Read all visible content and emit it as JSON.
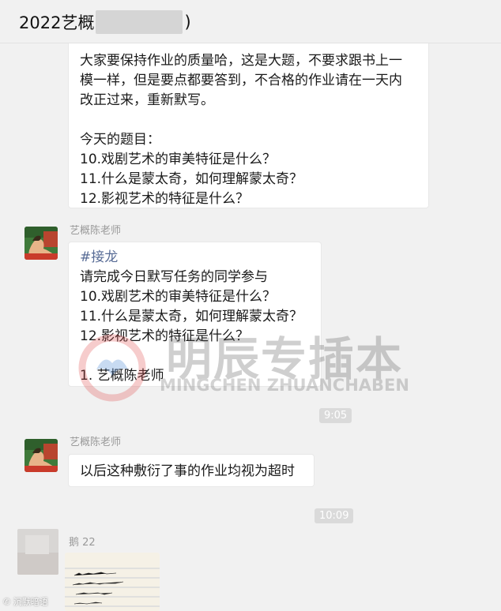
{
  "chat": {
    "title_prefix": "2022艺概",
    "title_suffix": ")"
  },
  "messages": {
    "m1": {
      "lines": [
        "大家要保持作业的质量哈，这是大题，不要求跟书上一",
        "模一样，但是要点都要答到，不合格的作业请在一天内",
        "改正过来，重新默写。",
        "今天的题目：",
        "10.戏剧艺术的审美特征是什么？",
        "11.什么是蒙太奇，如何理解蒙太奇？",
        "12.影视艺术的特征是什么？"
      ]
    },
    "m2": {
      "sender": "艺概陈老师",
      "hashtag": "#接龙",
      "lines": [
        "请完成今日默写任务的同学参与",
        "10.戏剧艺术的审美特征是什么？",
        "11.什么是蒙太奇，如何理解蒙太奇？",
        "12.影视艺术的特征是什么？",
        "1. 艺概陈老师"
      ]
    },
    "time1": "9:05",
    "m3": {
      "sender": "艺概陈老师",
      "text": "以后这种敷衍了事的作业均视为超时"
    },
    "time2": "10:09",
    "m4": {
      "sender": "鹅 22"
    }
  },
  "watermark": {
    "cn": "明辰专插本",
    "en": "MINGCHEN ZHUANCHABEN"
  },
  "corner_watermark": "沉默暗语"
}
